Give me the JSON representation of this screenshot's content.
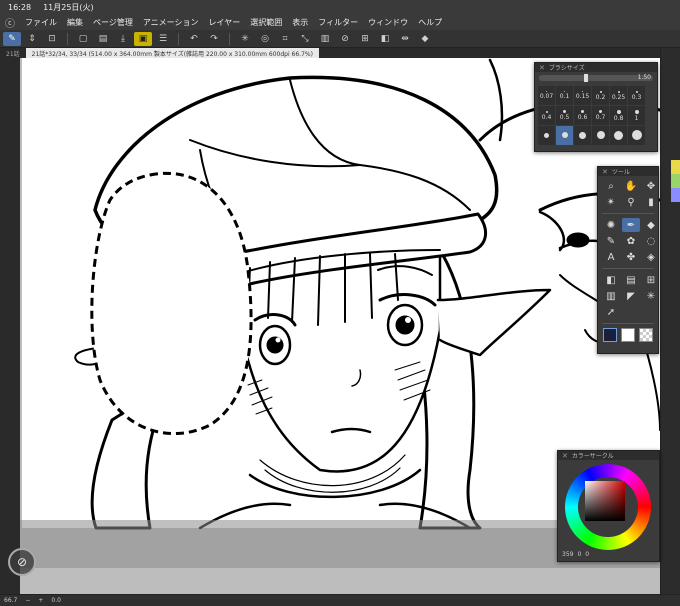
{
  "status": {
    "time": "16:28",
    "date": "11月25日(火)"
  },
  "menu": [
    "ファイル",
    "編集",
    "ページ管理",
    "アニメーション",
    "レイヤー",
    "選択範囲",
    "表示",
    "フィルター",
    "ウィンドウ",
    "ヘルプ"
  ],
  "tabs": {
    "prev": "21話",
    "current": "21話*32/34, 33/34 (514.00 x 364.00mm 製本サイズ(雑誌用 220.00 x 310.00mm 600dpi 66.7%)"
  },
  "brush_panel": {
    "title": "ブラシサイズ",
    "value": "1.50",
    "sizes": [
      "0.07",
      "0.1",
      "0.15",
      "0.2",
      "0.25",
      "0.3",
      "0.4",
      "0.5",
      "0.6",
      "0.7",
      "0.8",
      "1",
      "",
      "",
      "",
      "",
      "",
      ""
    ]
  },
  "tool_panel": {
    "title": "ツール"
  },
  "color_panel": {
    "title": "カラーサークル",
    "readout": "359",
    "s": "0",
    "v": "0"
  },
  "bottom": {
    "zoom": "66.7",
    "angle": "0.0"
  },
  "colors": {
    "accent": "#4a6fa5",
    "fg_color": "#1a1f3a",
    "bg_color": "#ffffff"
  }
}
